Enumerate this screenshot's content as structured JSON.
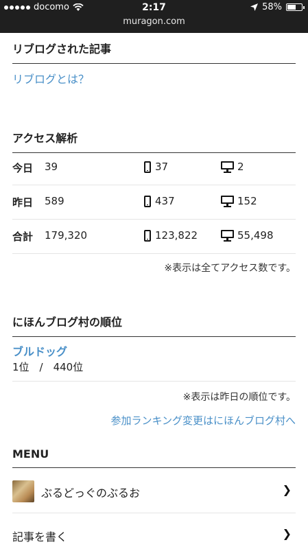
{
  "status_bar": {
    "carrier": "docomo",
    "time": "2:17",
    "url": "muragon.com",
    "battery_percent": "58%",
    "battery_level": 0.58
  },
  "reblog": {
    "title": "リブログされた記事",
    "link": "リブログとは？"
  },
  "access": {
    "title": "アクセス解析",
    "rows": [
      {
        "label": "今日",
        "total": "39",
        "mobile": "37",
        "pc": "2"
      },
      {
        "label": "昨日",
        "total": "589",
        "mobile": "437",
        "pc": "152"
      },
      {
        "label": "合計",
        "total": "179,320",
        "mobile": "123,822",
        "pc": "55,498"
      }
    ],
    "note": "※表示は全てアクセス数です。"
  },
  "nihon": {
    "title": "にほんブログ村の順位",
    "category": "ブルドッグ",
    "rank": "1位　/　440位",
    "note": "※表示は昨日の順位です。",
    "link": "参加ランキング変更はにほんブログ村へ"
  },
  "menu": {
    "title": "MENU",
    "items": [
      {
        "label": "ぶるどっぐのぶるお"
      },
      {
        "label": "記事を書く"
      }
    ]
  },
  "icons": {
    "signal": "signal-dots-icon",
    "wifi": "wifi-icon",
    "location": "location-arrow-icon",
    "battery": "battery-icon",
    "mobile": "smartphone-icon",
    "pc": "desktop-monitor-icon",
    "chevron": "chevron-right-icon"
  },
  "colors": {
    "link": "#4a90c8",
    "status_bar_bg": "#1f1f1f"
  }
}
